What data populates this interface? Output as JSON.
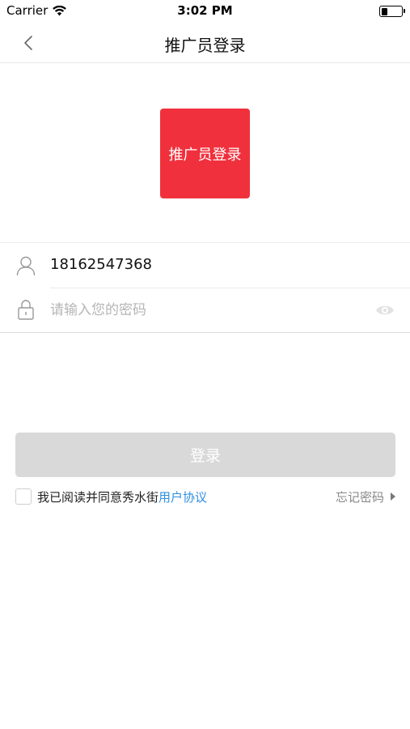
{
  "status_bar": {
    "carrier": "Carrier",
    "time": "3:02 PM"
  },
  "nav": {
    "title": "推广员登录",
    "back_icon": "chevron-left-icon"
  },
  "logo": {
    "text": "推广员登录",
    "color": "#f0313d"
  },
  "form": {
    "phone_value": "18162547368",
    "password_placeholder": "请输入您的密码",
    "user_icon": "user-icon",
    "lock_icon": "lock-icon",
    "eye_icon": "eye-icon"
  },
  "login_button": {
    "label": "登录",
    "color": "#d9d9d9"
  },
  "agreement": {
    "prefix": "我已阅读并同意秀水街",
    "link_label": "用户协议",
    "link_color": "#2f8fe0"
  },
  "forgot_password": {
    "label": "忘记密码"
  }
}
